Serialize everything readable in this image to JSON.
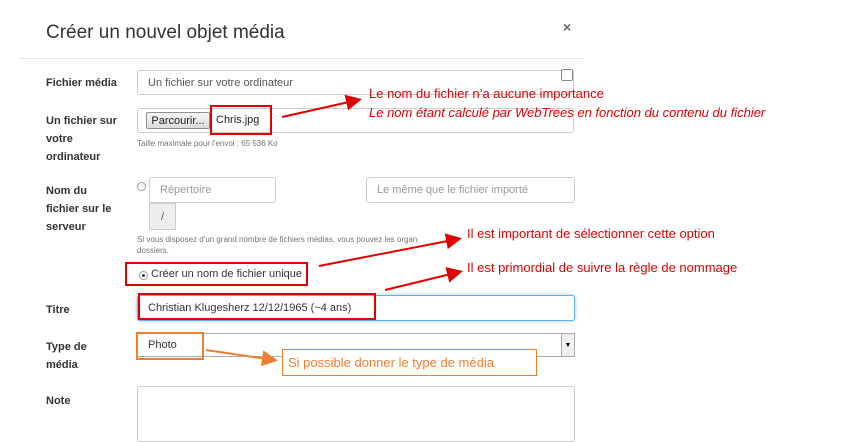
{
  "dialog": {
    "title": "Créer un nouvel objet média",
    "close_glyph": "×"
  },
  "form": {
    "media_file": {
      "label": "Fichier média",
      "select_value": "Un fichier sur votre ordinateur"
    },
    "local_file": {
      "label_line1": "Un fichier sur",
      "label_line2": "votre",
      "label_line3": "ordinateur",
      "browse_label": "Parcourir...",
      "file_name": "Chris.jpg",
      "help": "Taille maximale pour l'envoi : 65 536 Ko"
    },
    "server_name": {
      "label_line1": "Nom du",
      "label_line2": "fichier sur le",
      "label_line3": "serveur",
      "folder_placeholder": "Répertoire",
      "folder_separator": "/",
      "filename_placeholder": "Le même que le fichier importé",
      "help_line1": "Si vous disposez d'un grand nombre de fichiers médias, vous pouvez les organ",
      "help_line2": "dossiers.",
      "unique_option_label": "Créer un nom de fichier unique"
    },
    "title_field": {
      "label": "Titre",
      "value": "Christian Klugesherz 12/12/1965 (~4 ans)"
    },
    "media_type": {
      "label_line1": "Type de",
      "label_line2": "média",
      "value": "Photo",
      "caret": "▼"
    },
    "note": {
      "label": "Note",
      "value": ""
    }
  },
  "annotations": {
    "filename_note_line1": "Le nom du fichier n’a aucune importance",
    "filename_note_line2": "Le nom étant calculé par WebTrees en fonction du contenu du fichier",
    "option_note": "Il est important de sélectionner cette option",
    "naming_note": "Il est primordial de suivre la règle de nommage",
    "type_note": "Si possible donner le type de média"
  },
  "colors": {
    "annotation_red": "#e00000",
    "annotation_orange": "#ed7d31",
    "focus_blue": "#66afe9"
  }
}
